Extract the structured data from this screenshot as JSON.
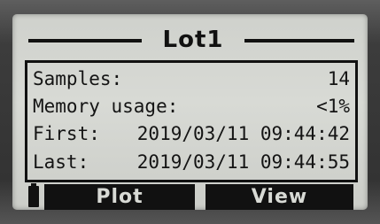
{
  "screen": {
    "title": "Lot1",
    "rows": [
      {
        "label": "Samples:",
        "value": "14"
      },
      {
        "label": "Memory usage:",
        "value": "<1%"
      },
      {
        "label": "First:",
        "value": "2019/03/11 09:44:42"
      },
      {
        "label": "Last:",
        "value": "2019/03/11 09:44:55"
      }
    ]
  },
  "softkeys": {
    "left_label": "Plot",
    "right_label": "View"
  },
  "icons": {
    "battery": "battery-icon"
  }
}
